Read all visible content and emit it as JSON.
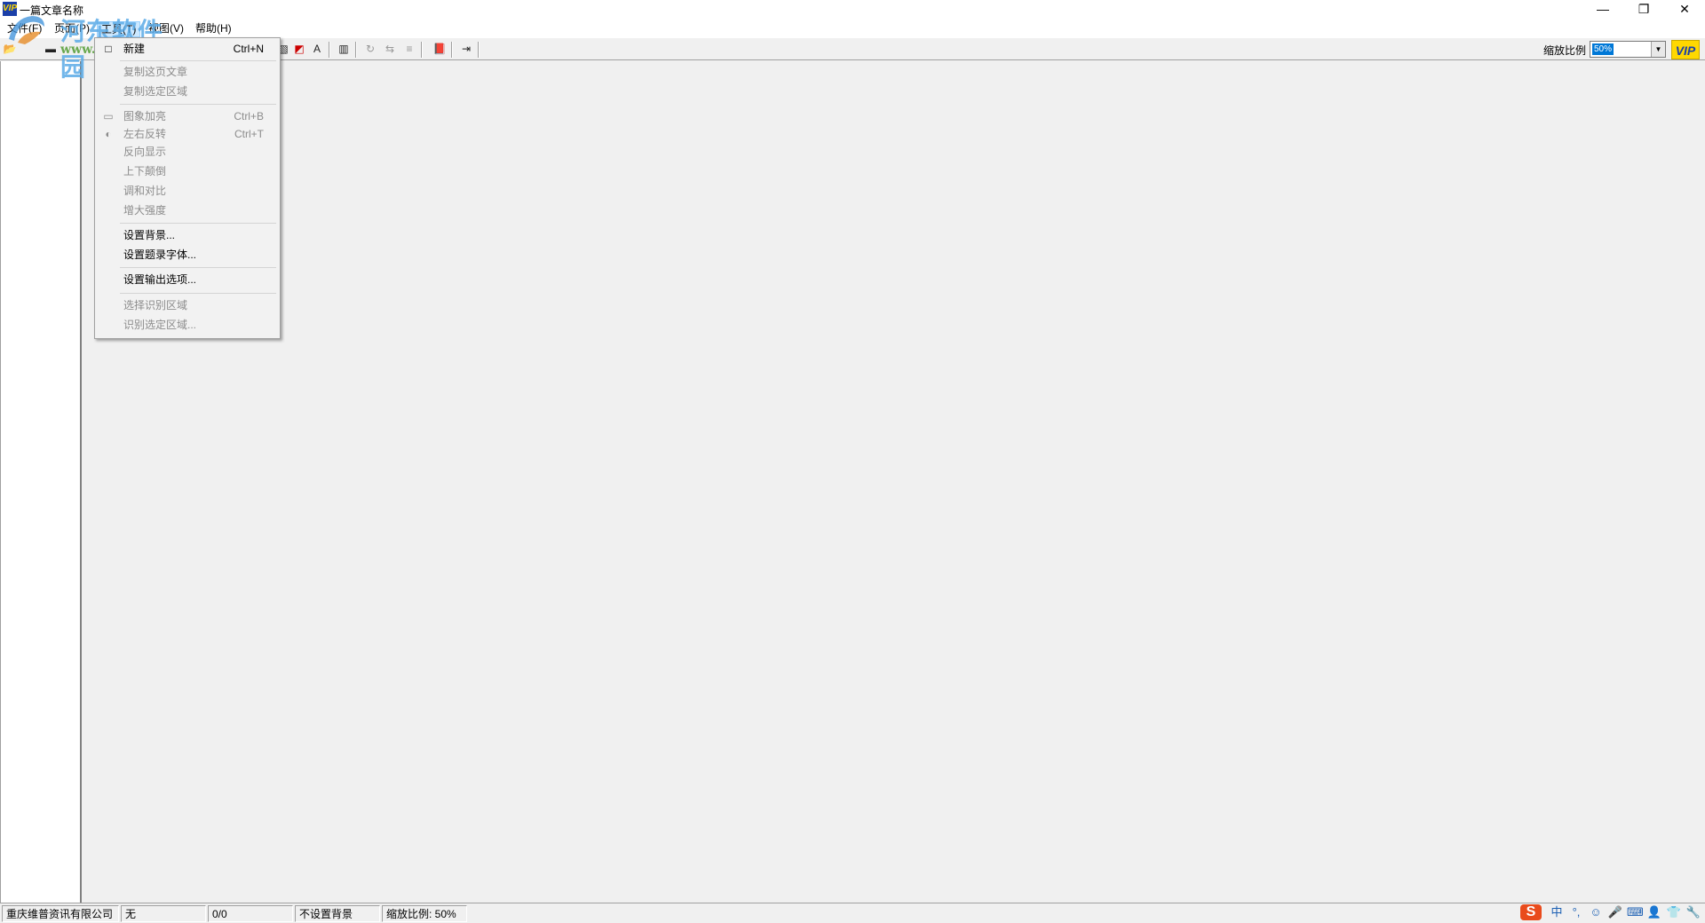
{
  "window": {
    "title": "一篇文章名称",
    "app_icon_text": "VIP",
    "minimize_glyph": "—",
    "maximize_glyph": "❐",
    "close_glyph": "✕"
  },
  "menubar": {
    "file": "文件(F)",
    "page": "页面(P)",
    "tools": "工具(T)",
    "view": "视图(V)",
    "help": "帮助(H)"
  },
  "toolbar": {
    "zoom_label": "缩放比例",
    "zoom_value": "50%",
    "zoom_arrow": "▼",
    "vip_text": "VIP",
    "icons": {
      "open": "📂",
      "save": "▬",
      "crop": "▧",
      "contrast": "◩",
      "text": "A",
      "chart": "▥",
      "rotate": "↻",
      "flip": "⇆",
      "list": "≡",
      "book": "📕",
      "exit": "⇥"
    }
  },
  "watermark": {
    "brand": "河东软件园",
    "url": "www.pc0359.cn"
  },
  "dropdown": {
    "items": [
      {
        "label": "新建",
        "shortcut": "Ctrl+N",
        "enabled": true,
        "icon": "□"
      },
      {
        "label": "复制这页文章",
        "shortcut": "",
        "enabled": false
      },
      {
        "label": "复制选定区域",
        "shortcut": "",
        "enabled": false
      },
      {
        "label": "图象加亮",
        "shortcut": "Ctrl+B",
        "enabled": false,
        "icon": "▭"
      },
      {
        "label": "左右反转",
        "shortcut": "Ctrl+T",
        "enabled": false,
        "icon": "◐"
      },
      {
        "label": "反向显示",
        "shortcut": "",
        "enabled": false
      },
      {
        "label": "上下颠倒",
        "shortcut": "",
        "enabled": false
      },
      {
        "label": "调和对比",
        "shortcut": "",
        "enabled": false
      },
      {
        "label": "增大强度",
        "shortcut": "",
        "enabled": false
      },
      {
        "label": "设置背景...",
        "shortcut": "",
        "enabled": true
      },
      {
        "label": "设置题录字体...",
        "shortcut": "",
        "enabled": true
      },
      {
        "label": "设置输出选项...",
        "shortcut": "",
        "enabled": true
      },
      {
        "label": "选择识别区域",
        "shortcut": "",
        "enabled": false
      },
      {
        "label": "识别选定区域...",
        "shortcut": "",
        "enabled": false
      }
    ]
  },
  "statusbar": {
    "company": "重庆维普资讯有限公司",
    "mode": "无",
    "page": "0/0",
    "background": "不设置背景",
    "zoom": "缩放比例: 50%"
  },
  "tray": {
    "sogou": "S",
    "lang": "中",
    "punct": "°,",
    "emoji": "☺",
    "mic": "🎤",
    "keyboard": "⌨",
    "user": "👤",
    "shirt": "👕",
    "tools": "🔧"
  },
  "colors": {
    "menu_highlight": "#cce8ff",
    "selection": "#0078d7",
    "vip_yellow": "#ffd800",
    "vip_blue": "#1a3fa8"
  }
}
